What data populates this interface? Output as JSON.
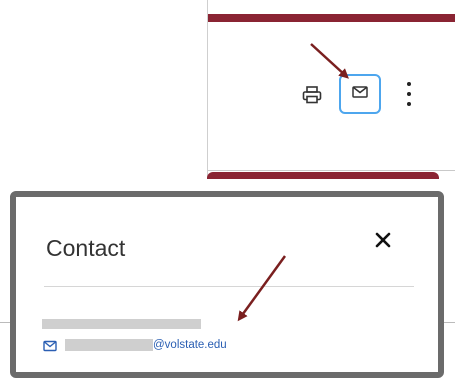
{
  "page": {
    "modal_title": "Contact",
    "email_domain": "@volstate.edu"
  },
  "colors": {
    "brand_maroon": "#8a2433",
    "focus_blue": "#4da6ee",
    "link_blue": "#2b5fb3",
    "arrow_red": "#7a1f1f",
    "modal_border": "#6b6b6b"
  },
  "icons": {
    "print": "printer-icon",
    "email": "envelope-icon",
    "more": "more-vertical-icon",
    "close": "close-icon",
    "contact_email": "envelope-icon"
  }
}
